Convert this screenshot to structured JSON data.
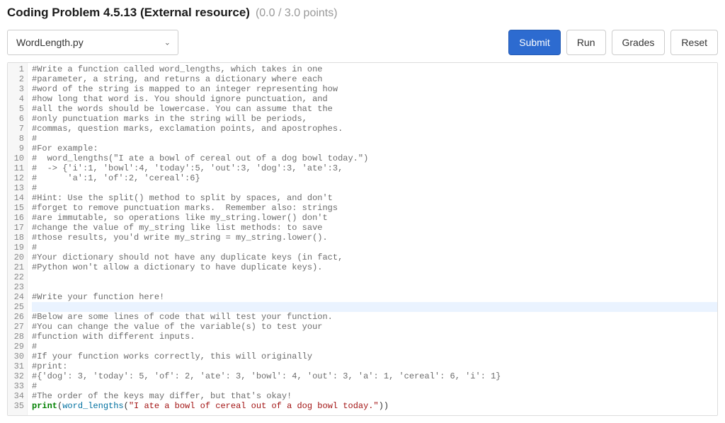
{
  "header": {
    "title": "Coding Problem 4.5.13 (External resource)",
    "points": "(0.0 / 3.0 points)"
  },
  "toolbar": {
    "file": "WordLength.py",
    "submit": "Submit",
    "run": "Run",
    "grades": "Grades",
    "reset": "Reset"
  },
  "editor": {
    "highlight_line": 25,
    "lines": [
      {
        "n": 1,
        "t": "comment",
        "text": "#Write a function called word_lengths, which takes in one"
      },
      {
        "n": 2,
        "t": "comment",
        "text": "#parameter, a string, and returns a dictionary where each"
      },
      {
        "n": 3,
        "t": "comment",
        "text": "#word of the string is mapped to an integer representing how"
      },
      {
        "n": 4,
        "t": "comment",
        "text": "#how long that word is. You should ignore punctuation, and"
      },
      {
        "n": 5,
        "t": "comment",
        "text": "#all the words should be lowercase. You can assume that the"
      },
      {
        "n": 6,
        "t": "comment",
        "text": "#only punctuation marks in the string will be periods,"
      },
      {
        "n": 7,
        "t": "comment",
        "text": "#commas, question marks, exclamation points, and apostrophes."
      },
      {
        "n": 8,
        "t": "comment",
        "text": "#"
      },
      {
        "n": 9,
        "t": "comment",
        "text": "#For example:"
      },
      {
        "n": 10,
        "t": "comment",
        "text": "#  word_lengths(\"I ate a bowl of cereal out of a dog bowl today.\")"
      },
      {
        "n": 11,
        "t": "comment",
        "text": "#  -> {'i':1, 'bowl':4, 'today':5, 'out':3, 'dog':3, 'ate':3,"
      },
      {
        "n": 12,
        "t": "comment",
        "text": "#      'a':1, 'of':2, 'cereal':6}"
      },
      {
        "n": 13,
        "t": "comment",
        "text": "#"
      },
      {
        "n": 14,
        "t": "comment",
        "text": "#Hint: Use the split() method to split by spaces, and don't"
      },
      {
        "n": 15,
        "t": "comment",
        "text": "#forget to remove punctuation marks.  Remember also: strings"
      },
      {
        "n": 16,
        "t": "comment",
        "text": "#are immutable, so operations like my_string.lower() don't"
      },
      {
        "n": 17,
        "t": "comment",
        "text": "#change the value of my_string like list methods: to save"
      },
      {
        "n": 18,
        "t": "comment",
        "text": "#those results, you'd write my_string = my_string.lower()."
      },
      {
        "n": 19,
        "t": "comment",
        "text": "#"
      },
      {
        "n": 20,
        "t": "comment",
        "text": "#Your dictionary should not have any duplicate keys (in fact,"
      },
      {
        "n": 21,
        "t": "comment",
        "text": "#Python won't allow a dictionary to have duplicate keys)."
      },
      {
        "n": 22,
        "t": "blank",
        "text": ""
      },
      {
        "n": 23,
        "t": "blank",
        "text": ""
      },
      {
        "n": 24,
        "t": "comment",
        "text": "#Write your function here!"
      },
      {
        "n": 25,
        "t": "blank",
        "text": ""
      },
      {
        "n": 26,
        "t": "comment",
        "text": "#Below are some lines of code that will test your function."
      },
      {
        "n": 27,
        "t": "comment",
        "text": "#You can change the value of the variable(s) to test your"
      },
      {
        "n": 28,
        "t": "comment",
        "text": "#function with different inputs."
      },
      {
        "n": 29,
        "t": "comment",
        "text": "#"
      },
      {
        "n": 30,
        "t": "comment",
        "text": "#If your function works correctly, this will originally"
      },
      {
        "n": 31,
        "t": "comment",
        "text": "#print:"
      },
      {
        "n": 32,
        "t": "comment",
        "text": "#{'dog': 3, 'today': 5, 'of': 2, 'ate': 3, 'bowl': 4, 'out': 3, 'a': 1, 'cereal': 6, 'i': 1}"
      },
      {
        "n": 33,
        "t": "comment",
        "text": "#"
      },
      {
        "n": 34,
        "t": "comment",
        "text": "#The order of the keys may differ, but that's okay!"
      },
      {
        "n": 35,
        "t": "code",
        "kw": "print",
        "fn": "word_lengths",
        "str": "\"I ate a bowl of cereal out of a dog bowl today.\""
      }
    ]
  }
}
